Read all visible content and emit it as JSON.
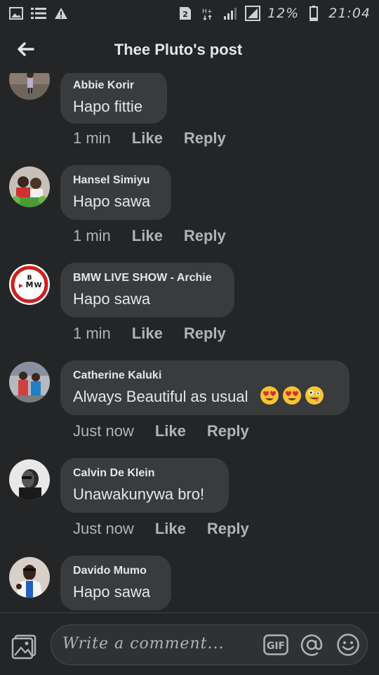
{
  "status_bar": {
    "battery_percent": "12%",
    "time": "21:04",
    "sim_label": "2",
    "left_icons": [
      "image-icon",
      "list-icon",
      "warning-icon"
    ]
  },
  "header": {
    "title": "Thee Pluto's post"
  },
  "actions": {
    "like_label": "Like",
    "reply_label": "Reply"
  },
  "comments": [
    {
      "author": "Abbie Korir",
      "text": "Hapo fittie",
      "time": "1 min"
    },
    {
      "author": "Hansel Simiyu",
      "text": "Hapo sawa",
      "time": "1 min"
    },
    {
      "author": "BMW LIVE SHOW - Archie",
      "text": "Hapo sawa",
      "time": "1 min"
    },
    {
      "author": "Catherine Kaluki",
      "text": "Always Beautiful as usual",
      "time": "Just now",
      "emojis": [
        "heart-eyes-emoji",
        "heart-eyes-emoji",
        "zany-face-emoji"
      ]
    },
    {
      "author": "Calvin De Klein",
      "text": "Unawakunywa bro!",
      "time": "Just now"
    },
    {
      "author": "Davido Mumo",
      "text": "Hapo sawa",
      "time": ""
    }
  ],
  "composer": {
    "placeholder": "Write a comment...",
    "gif_label": "GIF"
  },
  "colors": {
    "background": "#242526",
    "bubble": "#3a3b3c",
    "text": "#e4e6eb",
    "secondary_text": "#b0b3b8"
  }
}
